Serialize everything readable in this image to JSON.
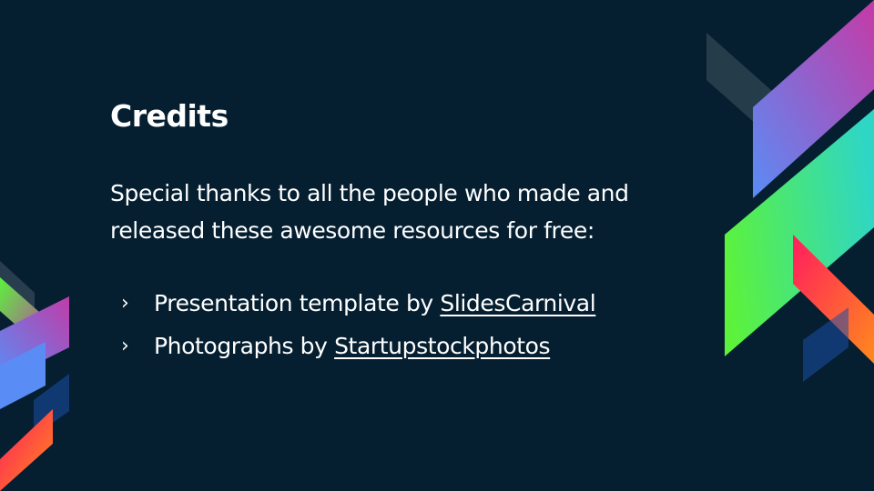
{
  "slide": {
    "title": "Credits",
    "body": "Special thanks to all the people who made and released these awesome resources for free:",
    "bullets": [
      {
        "marker": "›",
        "prefix": "Presentation template by ",
        "link": "SlidesCarnival"
      },
      {
        "marker": "›",
        "prefix": "Photographs by ",
        "link": "Startupstockphotos"
      }
    ]
  },
  "colors": {
    "background": "#051f31",
    "text": "#ffffff",
    "accent_purple": "#c03ca8",
    "accent_blue": "#5a8cf5",
    "accent_green": "#5cf23c",
    "accent_teal": "#2fd6c6",
    "accent_red": "#ff1d5e",
    "accent_orange": "#ff8a1c"
  }
}
